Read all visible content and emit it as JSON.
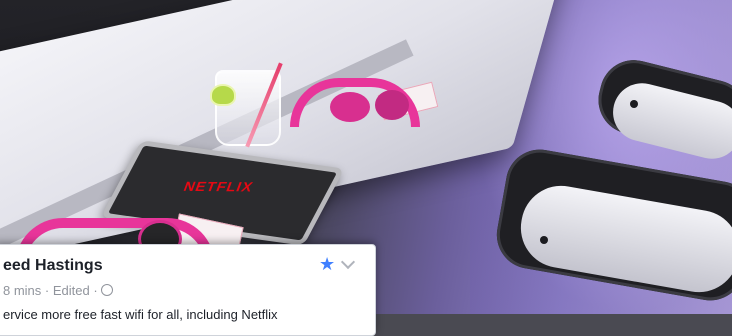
{
  "post": {
    "author": "eed Hastings",
    "meta": "8 mins · Edited ·",
    "body": "ervice more free fast wifi for all, including Netflix",
    "star_icon": "star-icon",
    "chevron_icon": "chevron-down-icon",
    "globe_icon": "globe-icon",
    "accent_color": "#4080ff"
  },
  "photo": {
    "tablet_logo": "NETFLIX",
    "headphone_color": "#e8359a"
  }
}
